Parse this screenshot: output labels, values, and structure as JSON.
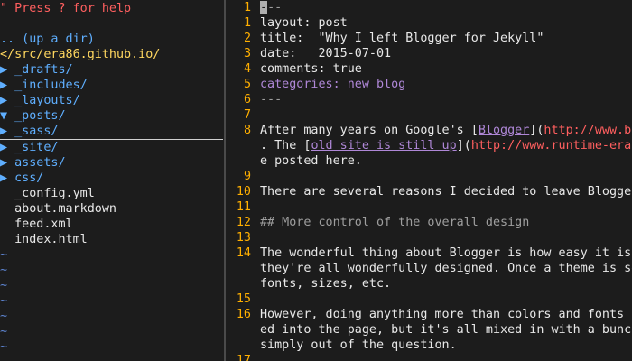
{
  "nerdtree": {
    "help": "\" Press ? for help",
    "updir": ".. (up a dir)",
    "cwd": "</src/era86.github.io/",
    "entries": [
      {
        "arrow": "▶",
        "name": "_drafts/",
        "kind": "dir"
      },
      {
        "arrow": "▶",
        "name": "_includes/",
        "kind": "dir"
      },
      {
        "arrow": "▶",
        "name": "_layouts/",
        "kind": "dir"
      },
      {
        "arrow": "▼",
        "name": "_posts/",
        "kind": "dir"
      },
      {
        "arrow": "▶",
        "name": "_sass/",
        "kind": "dir"
      },
      {
        "arrow": "▶",
        "name": "_site/",
        "kind": "dir"
      },
      {
        "arrow": "▶",
        "name": "assets/",
        "kind": "dir"
      },
      {
        "arrow": "▶",
        "name": "css/",
        "kind": "dir"
      },
      {
        "arrow": "",
        "name": "_config.yml",
        "kind": "file"
      },
      {
        "arrow": "",
        "name": "about.markdown",
        "kind": "file"
      },
      {
        "arrow": "",
        "name": "feed.xml",
        "kind": "file"
      },
      {
        "arrow": "",
        "name": "index.html",
        "kind": "file"
      }
    ],
    "tilde": "~"
  },
  "editor": {
    "line_numbers": [
      "1",
      "1",
      "2",
      "3",
      "4",
      "5",
      "6",
      "7",
      "",
      "8",
      "",
      "",
      "9",
      "",
      "10",
      "",
      "11",
      "",
      "12",
      "",
      "13",
      "",
      "14",
      "",
      "",
      "15",
      "",
      "16",
      "",
      "",
      ""
    ],
    "l1_cursor": "-",
    "l1_rest": "--",
    "l_layout": "layout: post",
    "l_title": "title:  \"Why I left Blogger for Jekyll\"",
    "l_date": "date:   2015-07-01",
    "l_comments": "comments: true",
    "l_categories": "categories: new blog",
    "l_dashes": "---",
    "l8_a": "After many years on Google's [",
    "l8_link": "Blogger",
    "l8_b": "](",
    "l8_url": "http://www.b",
    "l8c_a": ". The [",
    "l8c_link": "old site is still up",
    "l8c_b": "](",
    "l8c_url": "http://www.runtime-era",
    "l8d": "e posted here.",
    "l10": "There are several reasons I decided to leave Blogger",
    "l12": "## More control of the overall design",
    "l14a": "The wonderful thing about Blogger is how easy it is",
    "l14b": "they're all wonderfully designed. Once a theme is se",
    "l14c": "fonts, sizes, etc.",
    "l16a": "However, doing anything more than colors and fonts r",
    "l16b": "ed into the page, but it's all mixed in with a bunch",
    "l16c": "simply out of the question.",
    "l17": "17"
  }
}
